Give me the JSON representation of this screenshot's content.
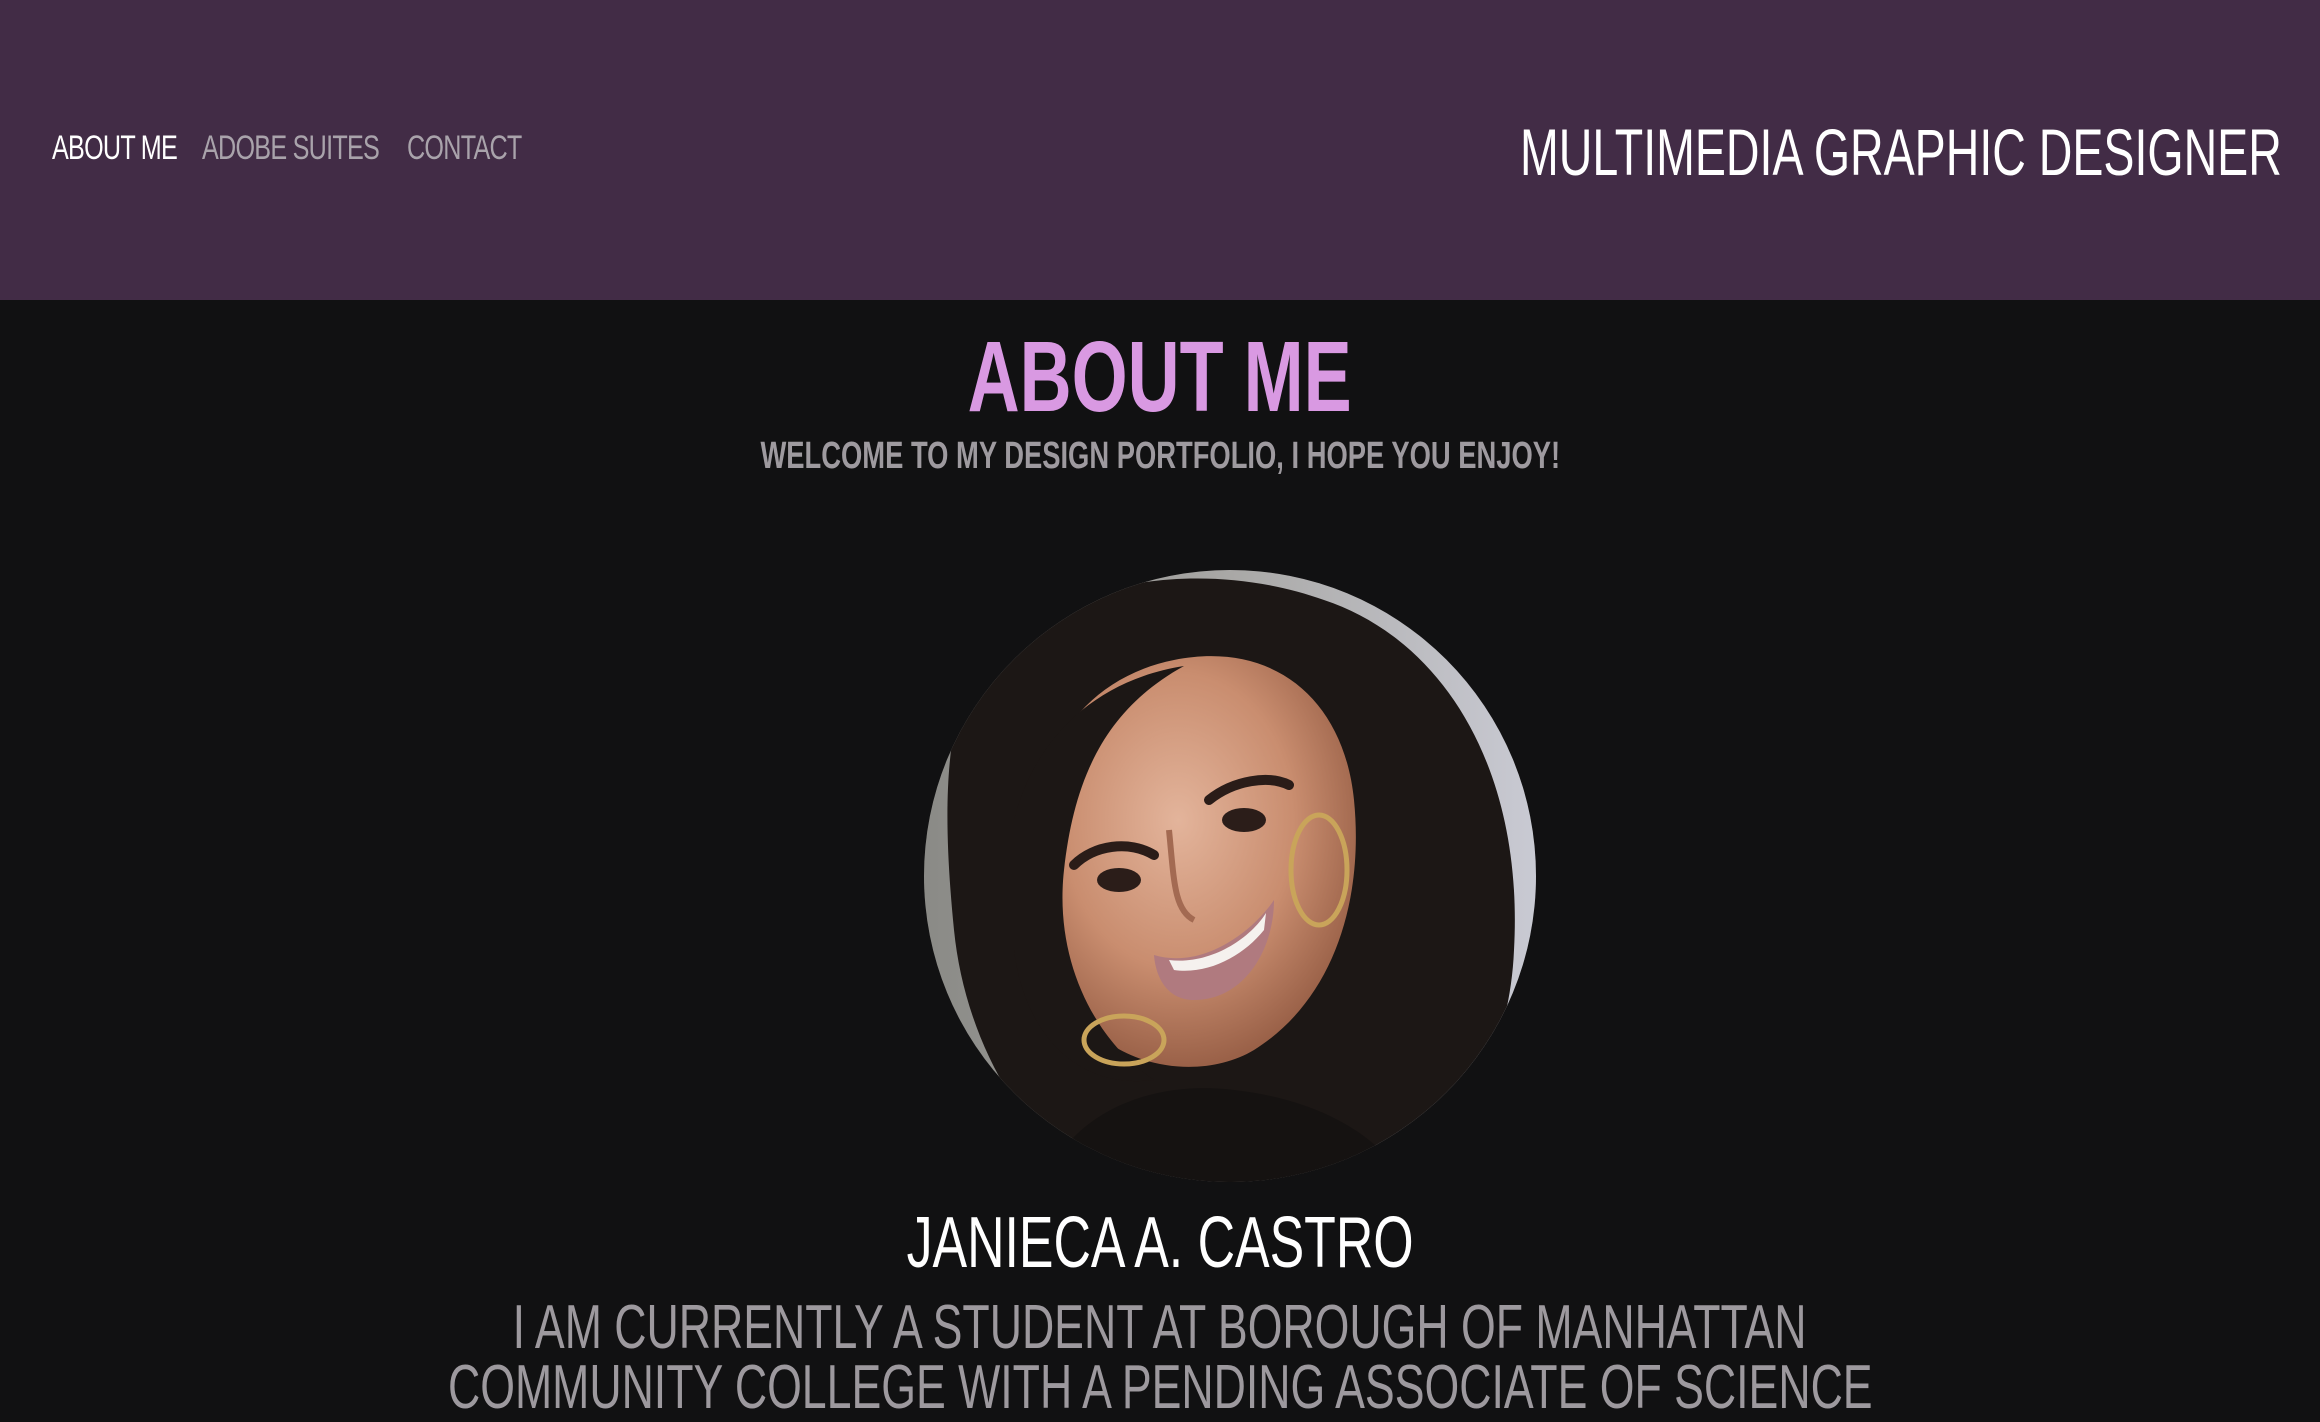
{
  "nav": {
    "items": [
      {
        "label": "ABOUT ME",
        "active": true
      },
      {
        "label": "ADOBE SUITES",
        "active": false
      },
      {
        "label": "CONTACT",
        "active": false
      }
    ]
  },
  "header": {
    "site_title": "MULTIMEDIA GRAPHIC DESIGNER"
  },
  "main": {
    "heading": "ABOUT ME",
    "tagline": "WELCOME TO MY DESIGN PORTFOLIO, I HOPE YOU ENJOY!",
    "name": "JANIECA A. CASTRO",
    "bio_lines": [
      "I AM CURRENTLY A STUDENT AT BOROUGH OF MANHATTAN",
      "COMMUNITY COLLEGE WITH A PENDING  ASSOCIATE OF SCIENCE"
    ]
  },
  "colors": {
    "header_bg": "#422c46",
    "page_bg": "#111112",
    "accent": "#d999e2",
    "muted_text": "#9e9a9f"
  }
}
